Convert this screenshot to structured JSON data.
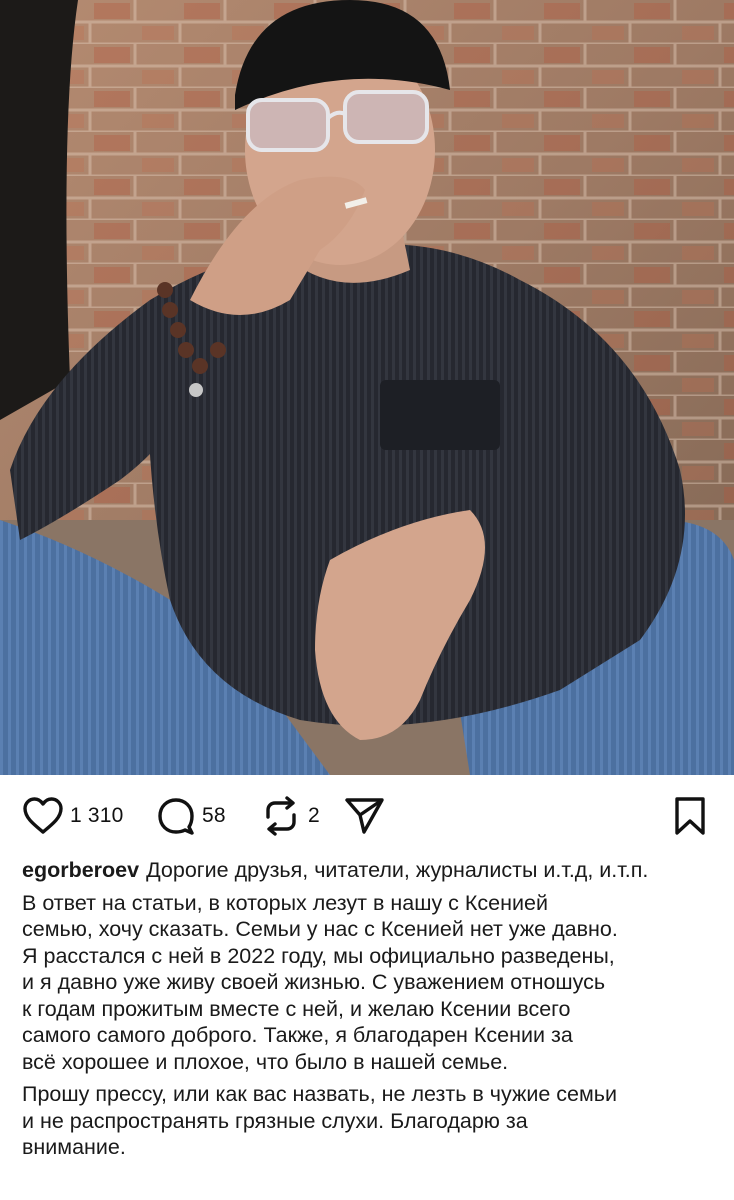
{
  "post": {
    "image_alt": "Man in black cap and sunglasses smoking, seated against a brick wall",
    "colors": {
      "wall": "#a8826a",
      "jacket": "#23252c",
      "jeans": "#4a6fa0",
      "text": "#111111"
    }
  },
  "actions": {
    "like_icon": "heart-icon",
    "likes": "1 310",
    "comment_icon": "comment-icon",
    "comments": "58",
    "repost_icon": "repost-icon",
    "reposts": "2",
    "share_icon": "send-icon",
    "save_icon": "bookmark-icon"
  },
  "caption": {
    "username": "egorberoev",
    "lead": "Дорогие друзья, читатели, журналисты и.т.д, и.т.п.",
    "paragraph1_lines": [
      "В ответ на статьи, в которых лезут в нашу с Ксенией",
      "семью, хочу сказать. Семьи у нас с Ксенией нет уже давно.",
      "Я расстался с ней  в 2022 году, мы официально разведены,",
      "и я давно уже живу своей жизнью. С уважением отношусь",
      "к годам прожитым вместе с ней, и желаю Ксении всего",
      "самого самого доброго. Также, я благодарен Ксении за",
      "всё хорошее и плохое, что было в нашей семье."
    ],
    "paragraph2_lines": [
      "Прошу прессу, или как вас назвать, не лезть в чужие семьи",
      "и не распространять грязные слухи. Благодарю за",
      "внимание."
    ]
  }
}
